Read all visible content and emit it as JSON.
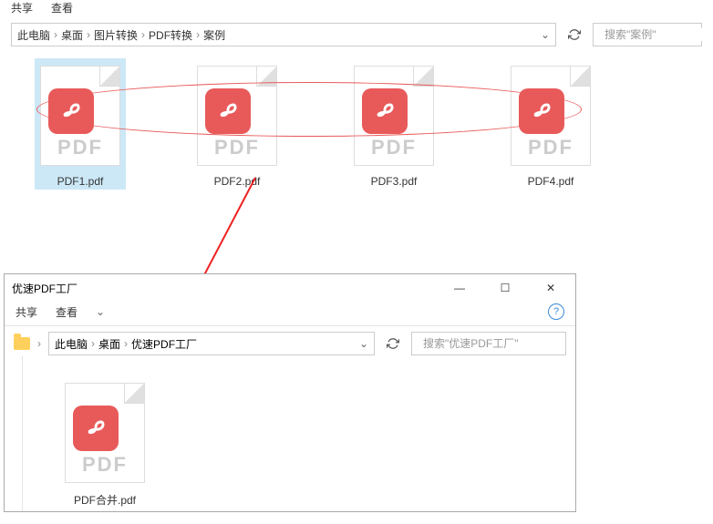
{
  "window1": {
    "menu": {
      "share": "共享",
      "view": "查看"
    },
    "breadcrumb": [
      "此电脑",
      "桌面",
      "图片转换",
      "PDF转换",
      "案例"
    ],
    "search_placeholder": "搜索\"案例\"",
    "files": [
      {
        "name": "PDF1.pdf"
      },
      {
        "name": "PDF2.pdf"
      },
      {
        "name": "PDF3.pdf"
      },
      {
        "name": "PDF4.pdf"
      }
    ]
  },
  "window2": {
    "title": "优速PDF工厂",
    "menu": {
      "share": "共享",
      "view": "查看"
    },
    "breadcrumb": [
      "此电脑",
      "桌面",
      "优速PDF工厂"
    ],
    "search_placeholder": "搜索\"优速PDF工厂\"",
    "files": [
      {
        "name": "PDF合并.pdf"
      }
    ]
  },
  "icons": {
    "pdf_text": "PDF"
  }
}
